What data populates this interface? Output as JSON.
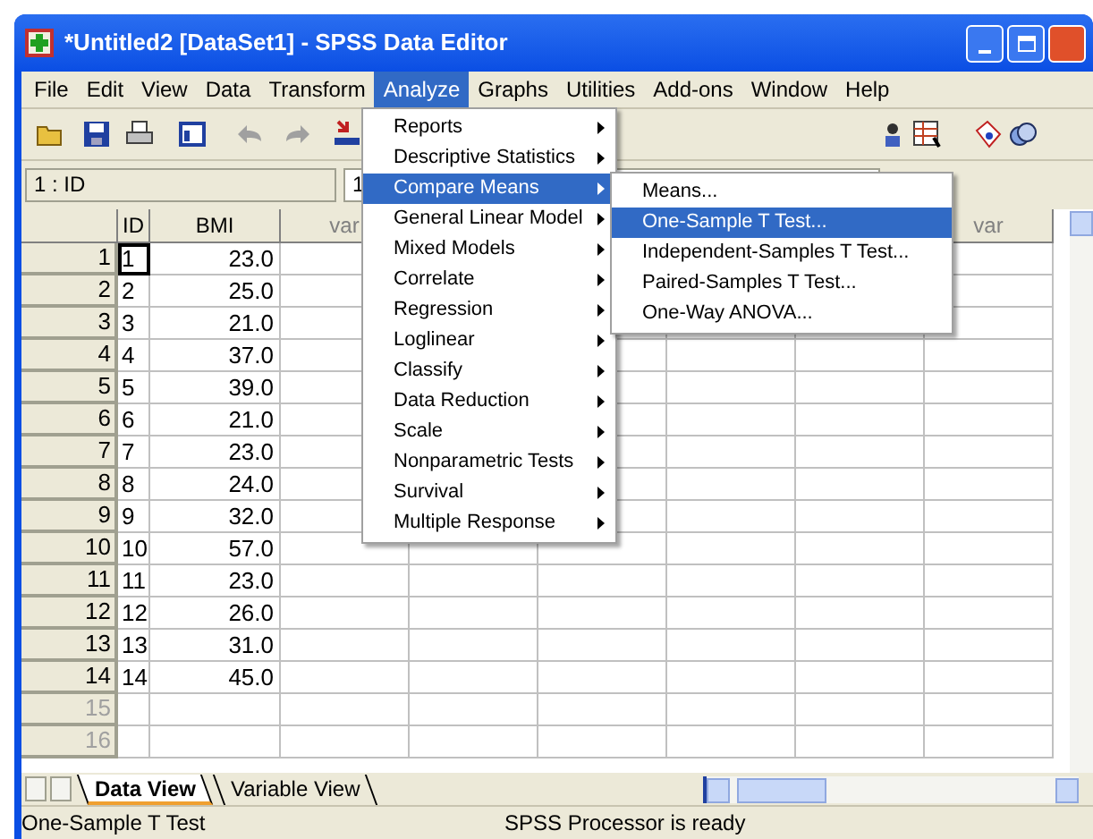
{
  "window": {
    "title": "*Untitled2 [DataSet1] - SPSS Data Editor"
  },
  "menu_bar": [
    {
      "label": "File",
      "selected": false
    },
    {
      "label": "Edit",
      "selected": false
    },
    {
      "label": "View",
      "selected": false
    },
    {
      "label": "Data",
      "selected": false
    },
    {
      "label": "Transform",
      "selected": false
    },
    {
      "label": "Analyze",
      "selected": true
    },
    {
      "label": "Graphs",
      "selected": false
    },
    {
      "label": "Utilities",
      "selected": false
    },
    {
      "label": "Add-ons",
      "selected": false
    },
    {
      "label": "Window",
      "selected": false
    },
    {
      "label": "Help",
      "selected": false
    }
  ],
  "cell_reference": {
    "name": "1 : ID",
    "value": "1"
  },
  "table": {
    "columns": [
      {
        "label": "ID"
      },
      {
        "label": "BMI"
      },
      {
        "label": "var"
      },
      {},
      {},
      {},
      {},
      {
        "label": "var"
      }
    ],
    "rows": [
      {
        "number": "1",
        "cells": [
          "1",
          "23.0"
        ],
        "disabled": false
      },
      {
        "number": "2",
        "cells": [
          "2",
          "25.0"
        ],
        "disabled": false
      },
      {
        "number": "3",
        "cells": [
          "3",
          "21.0"
        ],
        "disabled": false
      },
      {
        "number": "4",
        "cells": [
          "4",
          "37.0"
        ],
        "disabled": false
      },
      {
        "number": "5",
        "cells": [
          "5",
          "39.0"
        ],
        "disabled": false
      },
      {
        "number": "6",
        "cells": [
          "6",
          "21.0"
        ],
        "disabled": false
      },
      {
        "number": "7",
        "cells": [
          "7",
          "23.0"
        ],
        "disabled": false
      },
      {
        "number": "8",
        "cells": [
          "8",
          "24.0"
        ],
        "disabled": false
      },
      {
        "number": "9",
        "cells": [
          "9",
          "32.0"
        ],
        "disabled": false
      },
      {
        "number": "10",
        "cells": [
          "10",
          "57.0"
        ],
        "disabled": false
      },
      {
        "number": "11",
        "cells": [
          "11",
          "23.0"
        ],
        "disabled": false
      },
      {
        "number": "12",
        "cells": [
          "12",
          "26.0"
        ],
        "disabled": false
      },
      {
        "number": "13",
        "cells": [
          "13",
          "31.0"
        ],
        "disabled": false
      },
      {
        "number": "14",
        "cells": [
          "14",
          "45.0"
        ],
        "disabled": false
      },
      {
        "number": "15",
        "cells": [],
        "disabled": true
      },
      {
        "number": "16",
        "cells": [],
        "disabled": true
      }
    ]
  },
  "analyze_menu": [
    {
      "label": "Reports",
      "selected": false
    },
    {
      "label": "Descriptive Statistics",
      "selected": false
    },
    {
      "label": "Compare Means",
      "selected": true
    },
    {
      "label": "General Linear Model",
      "selected": false
    },
    {
      "label": "Mixed Models",
      "selected": false
    },
    {
      "label": "Correlate",
      "selected": false
    },
    {
      "label": "Regression",
      "selected": false
    },
    {
      "label": "Loglinear",
      "selected": false
    },
    {
      "label": "Classify",
      "selected": false
    },
    {
      "label": "Data Reduction",
      "selected": false
    },
    {
      "label": "Scale",
      "selected": false
    },
    {
      "label": "Nonparametric Tests",
      "selected": false
    },
    {
      "label": "Survival",
      "selected": false
    },
    {
      "label": "Multiple Response",
      "selected": false
    }
  ],
  "compare_means_menu": [
    {
      "label": "Means...",
      "selected": false
    },
    {
      "label": "One-Sample T Test...",
      "selected": true
    },
    {
      "label": "Independent-Samples T Test...",
      "selected": false
    },
    {
      "label": "Paired-Samples T Test...",
      "selected": false
    },
    {
      "label": "One-Way ANOVA...",
      "selected": false
    }
  ],
  "view_tabs": [
    {
      "label": "Data View",
      "selected": true
    },
    {
      "label": "Variable View",
      "selected": false
    }
  ],
  "status_bar": {
    "message": "One-Sample T Test",
    "processor": "SPSS Processor is ready"
  }
}
